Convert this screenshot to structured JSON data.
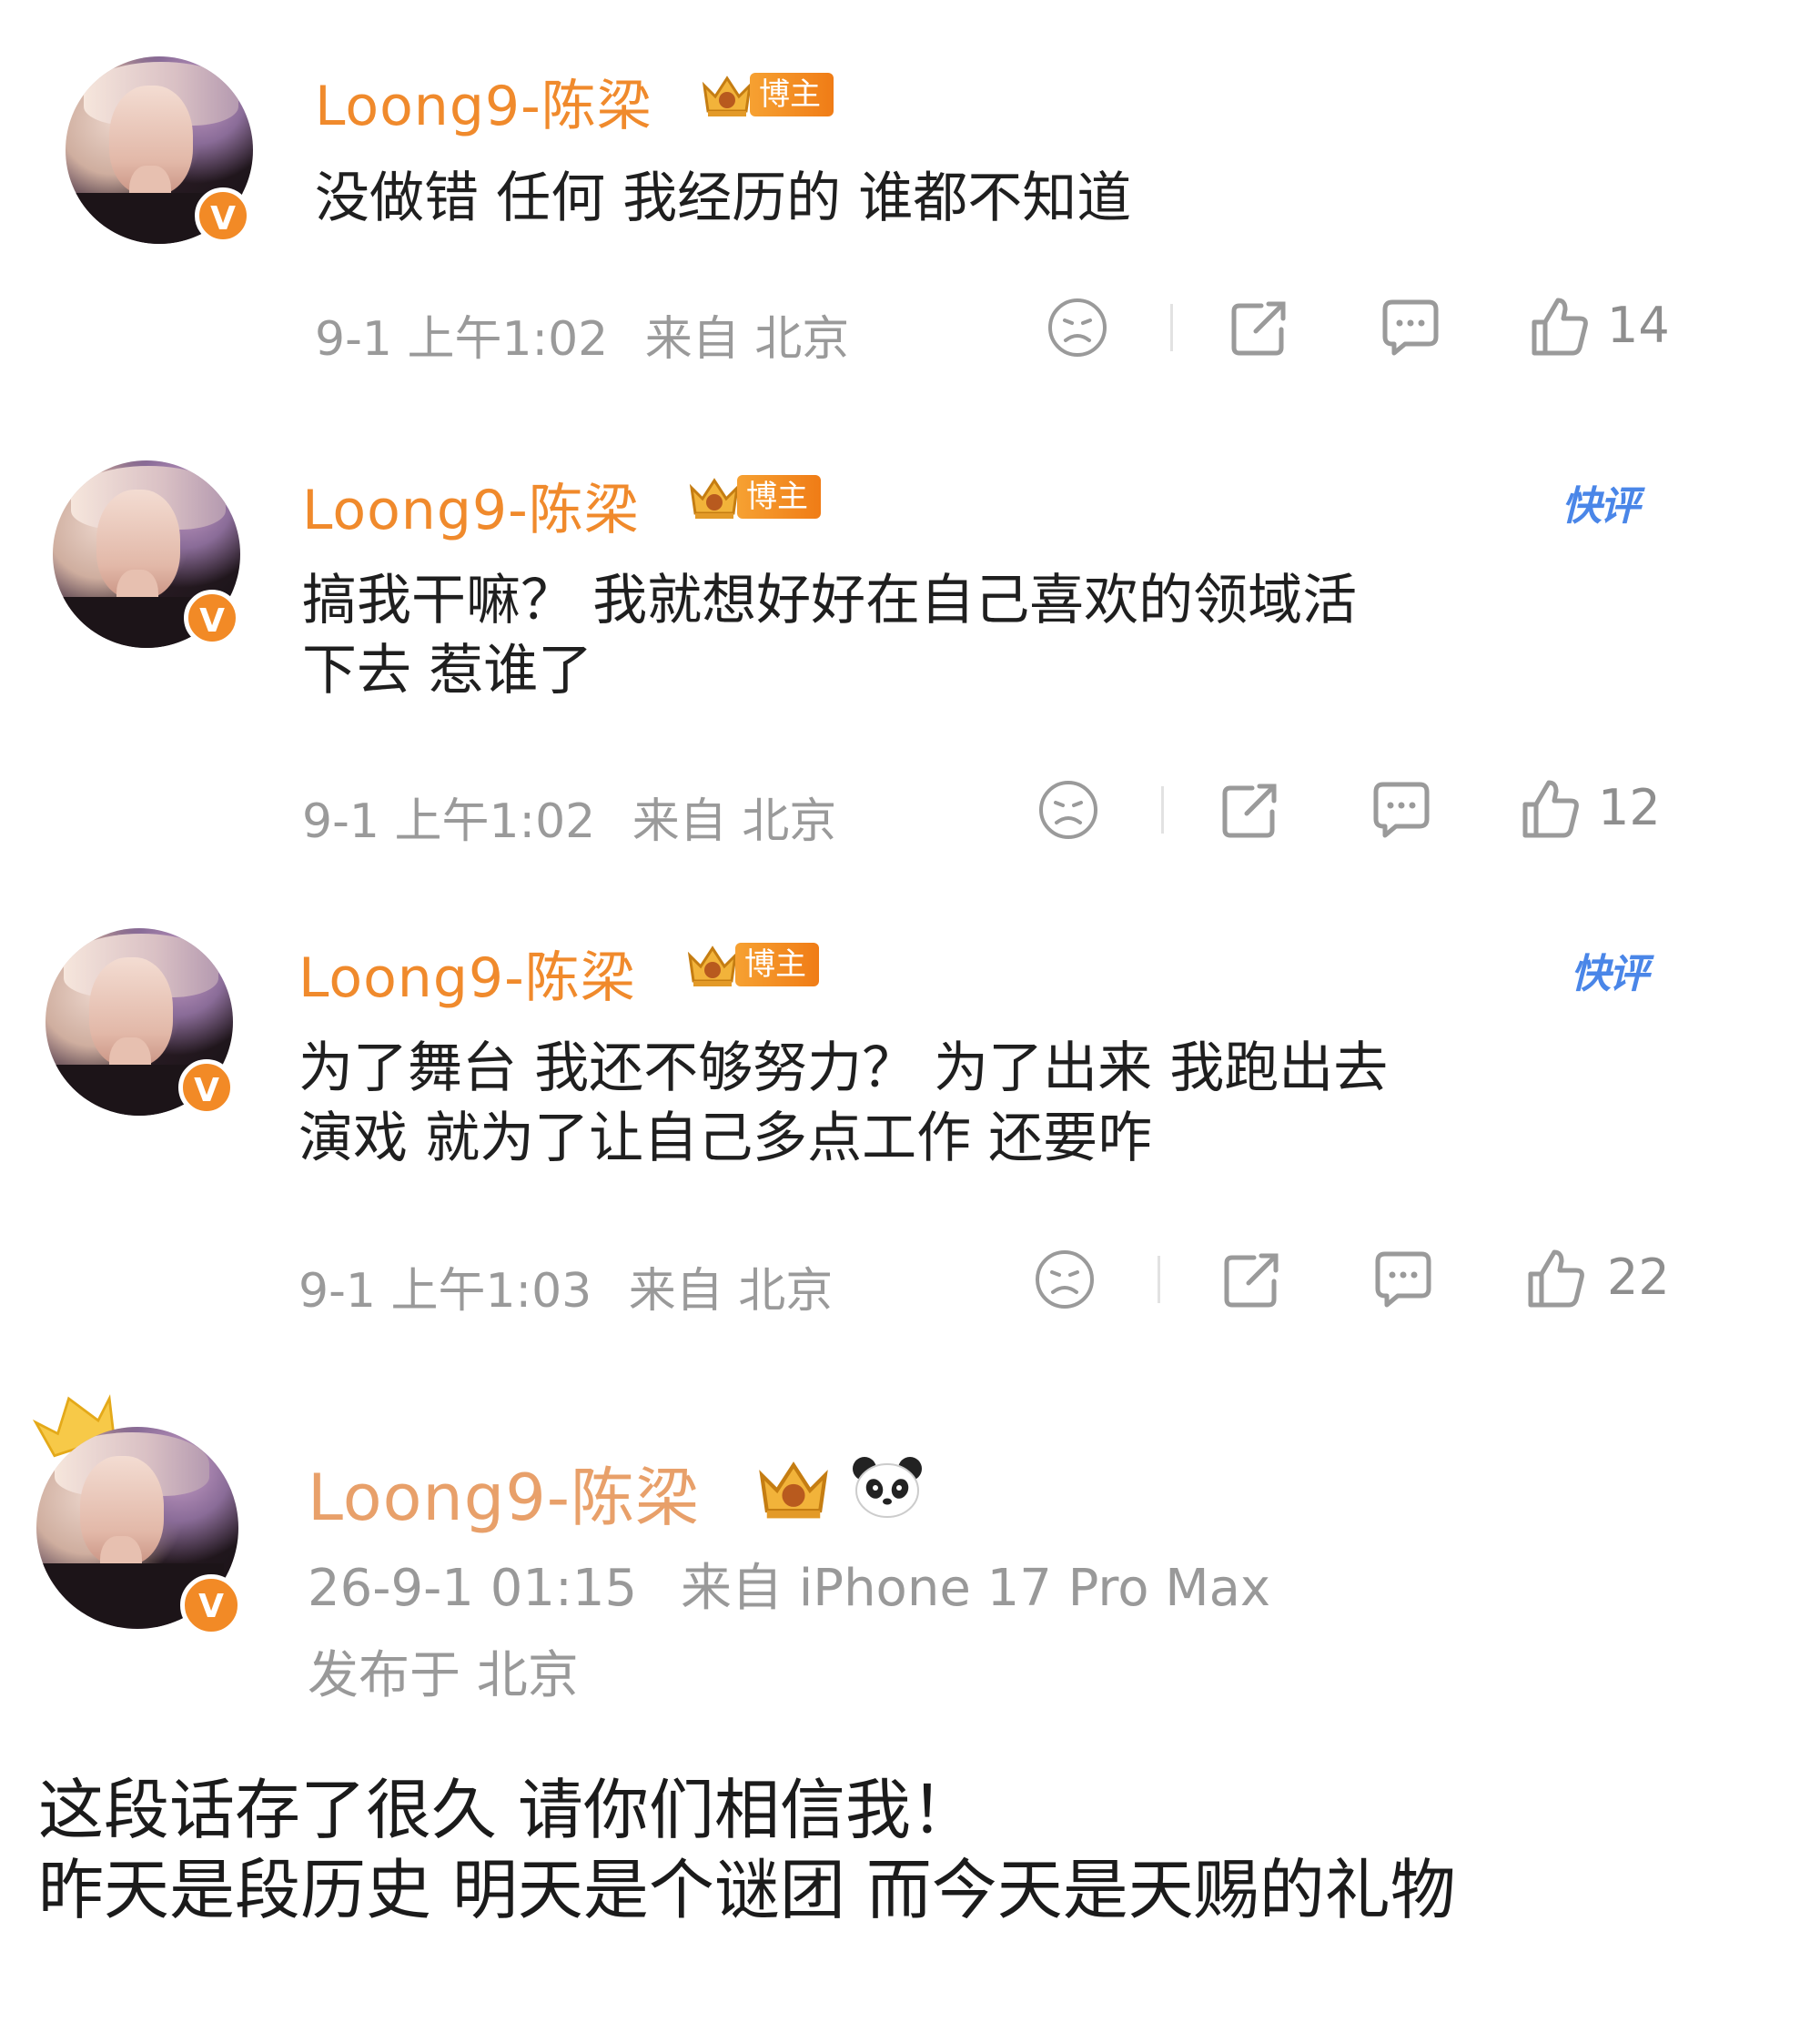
{
  "colors": {
    "username": "#f08a2c",
    "verified_badge": "#f28a26",
    "meta_text": "#9a9a9a",
    "kuaiping": "#4a86e8"
  },
  "comments": [
    {
      "username": "Loong9-陈梁",
      "badge_label": "博主",
      "text_lines": [
        "没做错 任何 我经历的 谁都不知道"
      ],
      "time": "9-1 上午1:02",
      "location": "来自 北京",
      "likes": "14",
      "kuaiping": ""
    },
    {
      "username": "Loong9-陈梁",
      "badge_label": "博主",
      "text_lines": [
        "搞我干嘛？ 我就想好好在自己喜欢的领域活",
        "下去 惹谁了"
      ],
      "time": "9-1 上午1:02",
      "location": "来自 北京",
      "likes": "12",
      "kuaiping": "快评"
    },
    {
      "username": "Loong9-陈梁",
      "badge_label": "博主",
      "text_lines": [
        "为了舞台 我还不够努力？ 为了出来 我跑出去",
        "演戏 就为了让自己多点工作 还要咋"
      ],
      "time": "9-1 上午1:03",
      "location": "来自 北京",
      "likes": "22",
      "kuaiping": "快评"
    }
  ],
  "post": {
    "username": "Loong9-陈梁",
    "datetime": "26-9-1 01:15",
    "source": "来自 iPhone 17 Pro Max",
    "published_in": "发布于 北京",
    "text_lines": [
      "这段话存了很久 请你们相信我！",
      "昨天是段历史 明天是个谜团 而今天是天赐的礼物"
    ]
  },
  "icons": {
    "dislike": "sad-face-icon",
    "share": "share-icon",
    "comment": "comment-icon",
    "like": "thumbs-up-icon",
    "verified": "verified-v-icon",
    "crown": "crown-icon",
    "panda": "panda-icon"
  },
  "verified_letter": "V"
}
